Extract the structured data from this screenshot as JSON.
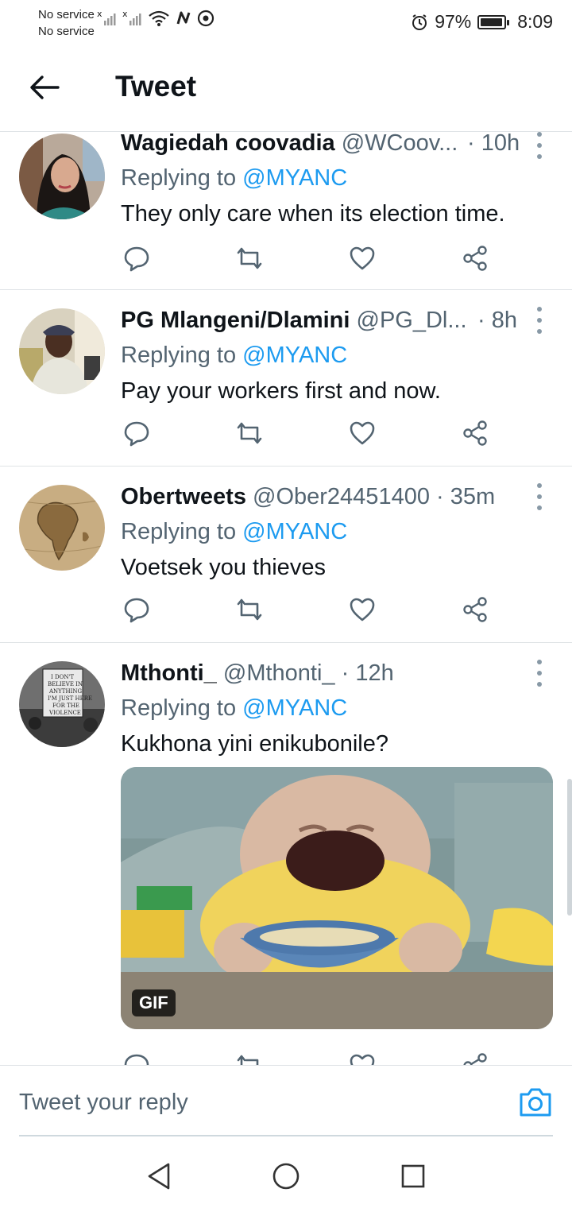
{
  "status": {
    "carrier_line1": "No service",
    "carrier_line2": "No service",
    "battery": "97%",
    "battery_level": 0.97,
    "time": "8:09"
  },
  "header": {
    "title": "Tweet"
  },
  "tweets": [
    {
      "name": "Wagiedah coovadia",
      "handle": "@WCoov...",
      "time": "· 10h",
      "replying_prefix": "Replying to",
      "replying_to": "@MYANC",
      "text": "They only care when its election time."
    },
    {
      "name": "PG Mlangeni/Dlamini",
      "handle": "@PG_Dl...",
      "time": "· 8h",
      "replying_prefix": "Replying to",
      "replying_to": "@MYANC",
      "text": "Pay your workers first and now."
    },
    {
      "name": "Obertweets",
      "handle": "@Ober24451400",
      "time": "· 35m",
      "replying_prefix": "Replying to",
      "replying_to": "@MYANC",
      "text": "Voetsek you thieves"
    },
    {
      "name": "Mthonti_",
      "handle": "@Mthonti_",
      "time": "· 12h",
      "replying_prefix": "Replying to",
      "replying_to": "@MYANC",
      "text": "Kukhona yini enikubonile?",
      "media_badge": "GIF"
    }
  ],
  "reply_bar": {
    "placeholder": "Tweet your reply"
  },
  "colors": {
    "accent": "#1d9bf0",
    "muted": "#536471",
    "text": "#0f1419",
    "divider": "#dfe3e6"
  },
  "icons": [
    "back-arrow-icon",
    "kebab-icon",
    "reply-icon",
    "retweet-icon",
    "like-icon",
    "share-icon",
    "camera-icon",
    "nav-back-icon",
    "nav-home-icon",
    "nav-recents-icon"
  ]
}
